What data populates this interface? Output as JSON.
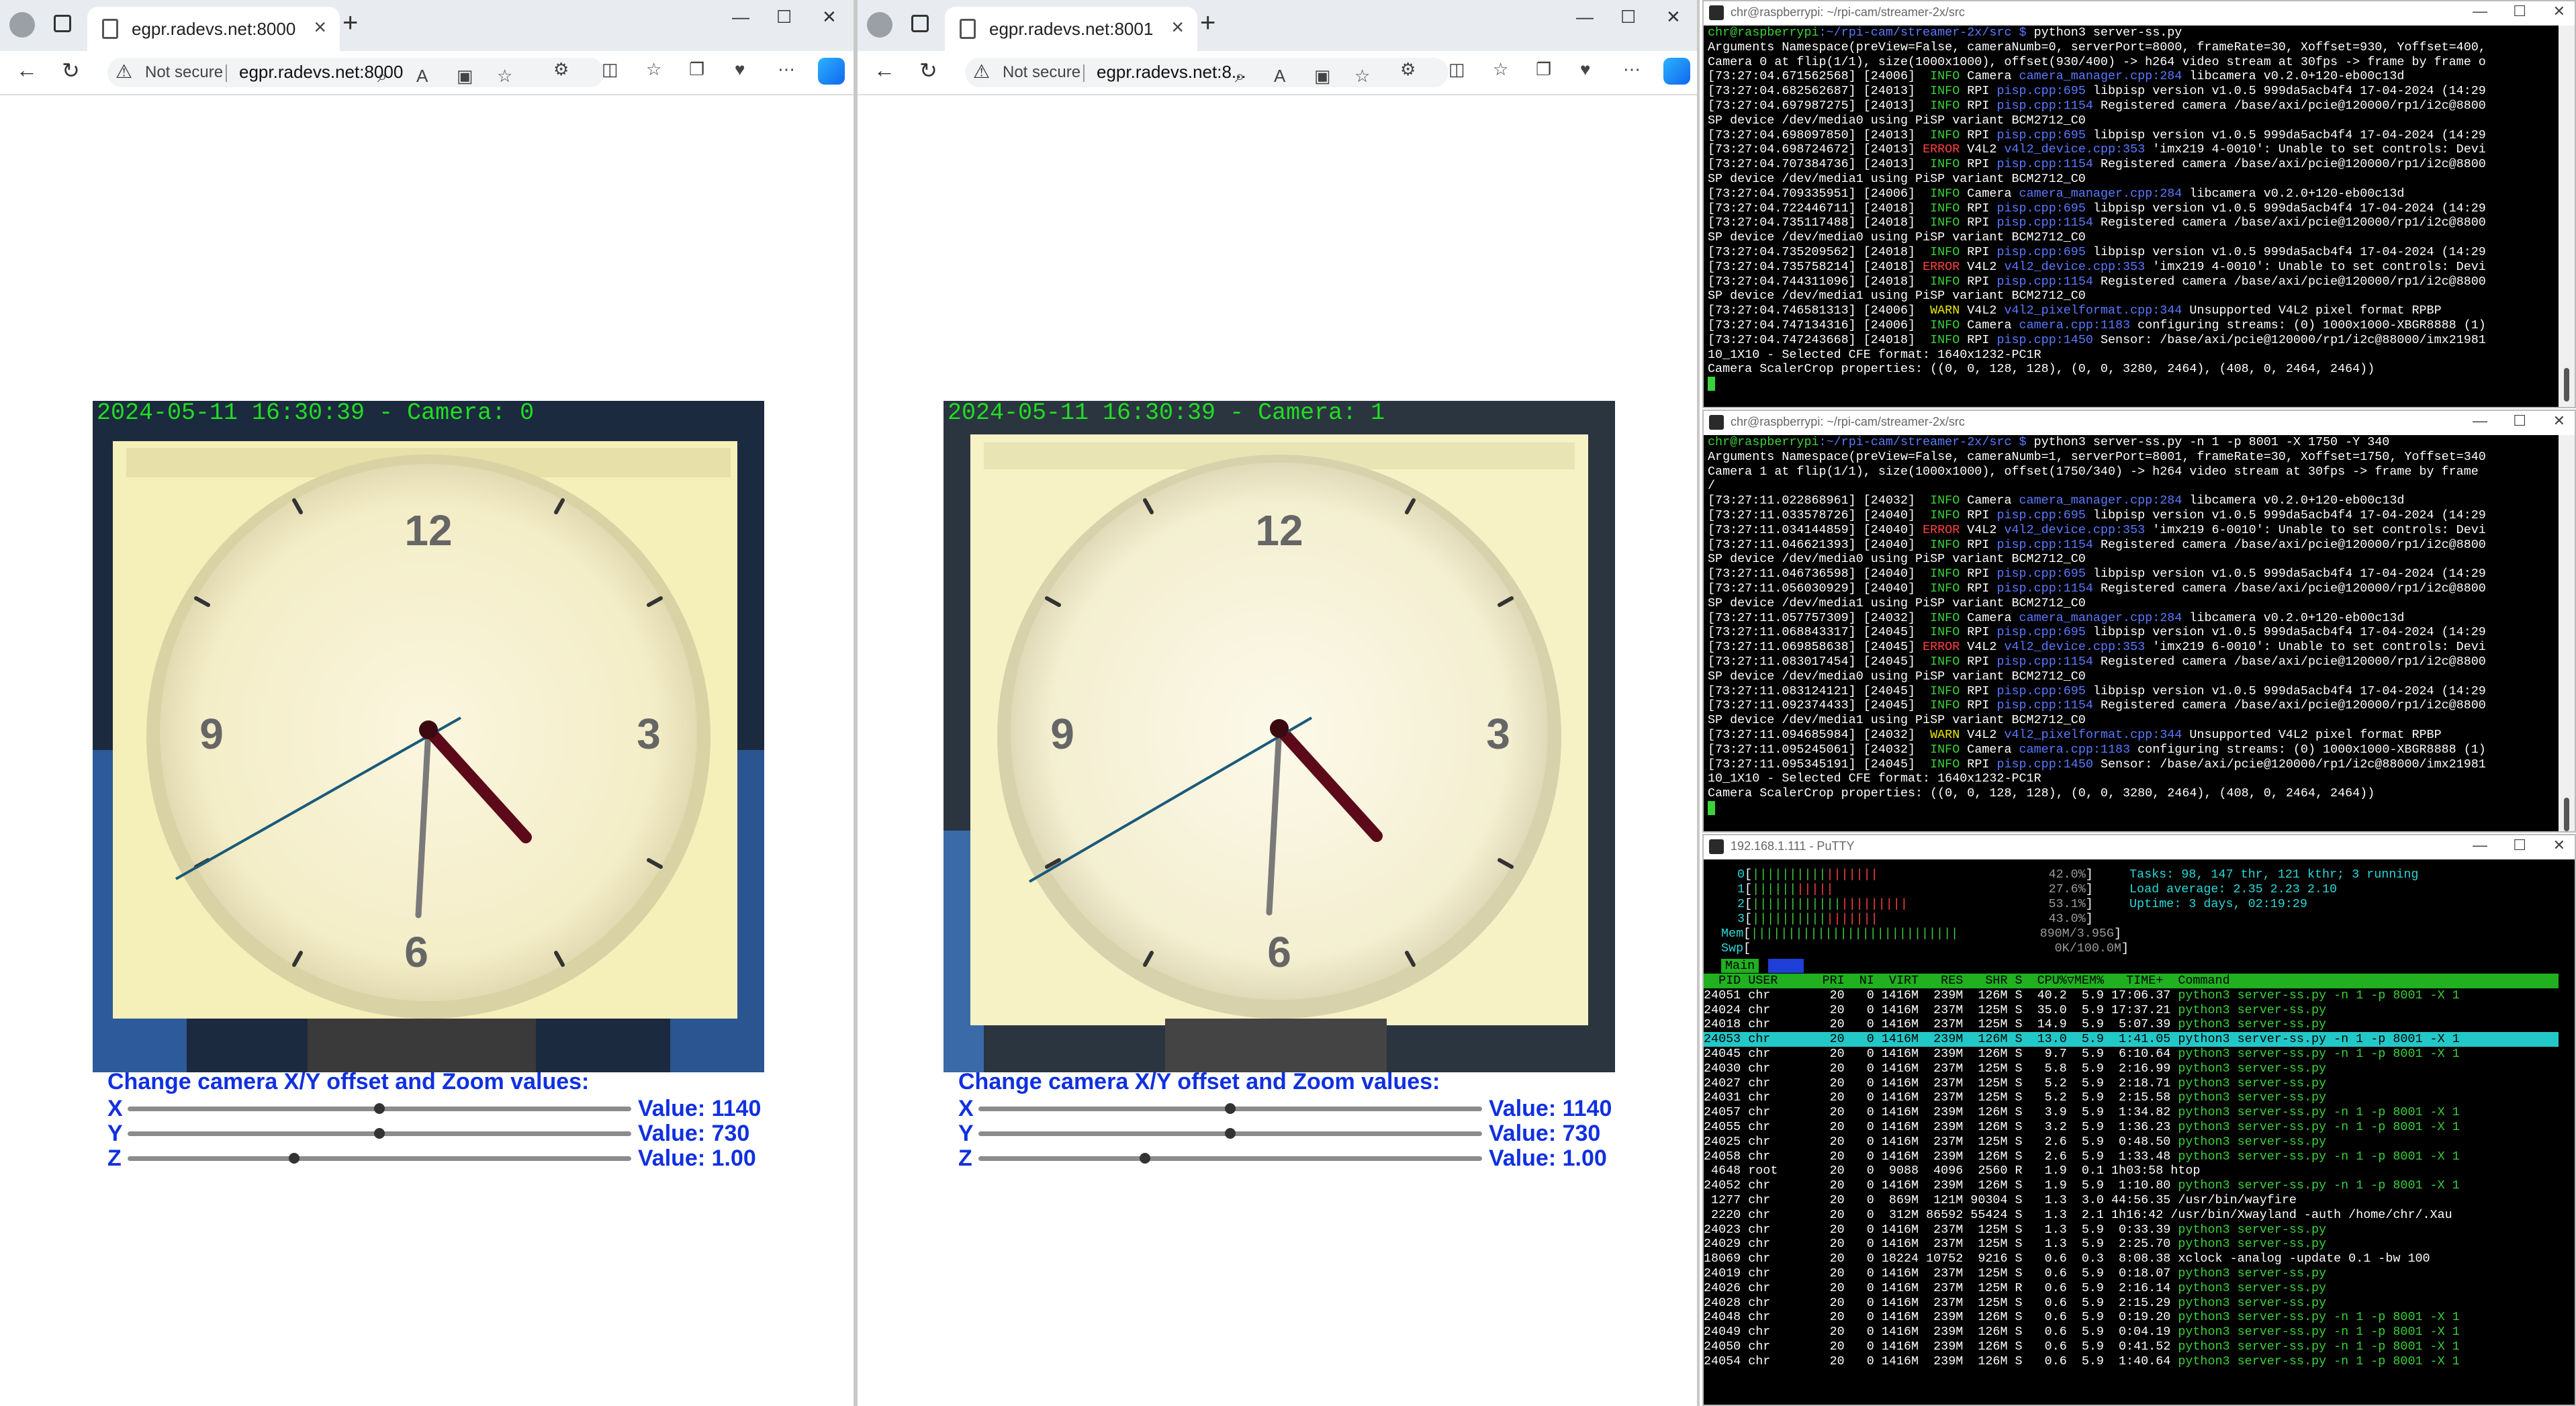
{
  "browser": {
    "address_warning": "Not secure",
    "windows": [
      {
        "tab_title": "egpr.radevs.net:8000",
        "url": "egpr.radevs.net:8000",
        "camera_overlay": "2024-05-11 16:30:39 - Camera: 0",
        "controls": {
          "title": "Change camera X/Y offset and Zoom values:",
          "sliders": [
            {
              "label": "X",
              "value_text": "Value: 1140",
              "fraction": 0.5
            },
            {
              "label": "Y",
              "value_text": "Value: 730",
              "fraction": 0.5
            },
            {
              "label": "Z",
              "value_text": "Value: 1.00",
              "fraction": 0.33
            }
          ]
        }
      },
      {
        "tab_title": "egpr.radevs.net:8001",
        "url": "egpr.radevs.net:8...",
        "camera_overlay": "2024-05-11 16:30:39 - Camera: 1",
        "controls": {
          "title": "Change camera X/Y offset and Zoom values:",
          "sliders": [
            {
              "label": "X",
              "value_text": "Value: 1140",
              "fraction": 0.5
            },
            {
              "label": "Y",
              "value_text": "Value: 730",
              "fraction": 0.5
            },
            {
              "label": "Z",
              "value_text": "Value: 1.00",
              "fraction": 0.33
            }
          ]
        }
      }
    ],
    "clock_numerals": [
      "12",
      "3",
      "6",
      "9"
    ]
  },
  "terminal1": {
    "title": "chr@raspberrypi: ~/rpi-cam/streamer-2x/src",
    "prompt": "chr@raspberrypi",
    "path": ":~/rpi-cam/streamer-2x/src $ ",
    "command": "python3 server-ss.py",
    "lines": [
      "Arguments Namespace(preView=False, cameraNumb=0, serverPort=8000, frameRate=30, Xoffset=930, Yoffset=400,",
      "Camera 0 at flip(1/1), size(1000x1000), offset(930/400) -> h264 video stream at 30fps -> frame by frame o",
      "[73:27:04.671562568] [24006]  INFO Camera camera_manager.cpp:284 libcamera v0.2.0+120-eb00c13d",
      "[73:27:04.682562687] [24013]  INFO RPI pisp.cpp:695 libpisp version v1.0.5 999da5acb4f4 17-04-2024 (14:29",
      "[73:27:04.697987275] [24013]  INFO RPI pisp.cpp:1154 Registered camera /base/axi/pcie@120000/rp1/i2c@8800",
      "SP device /dev/media0 using PiSP variant BCM2712_C0",
      "[73:27:04.698097850] [24013]  INFO RPI pisp.cpp:695 libpisp version v1.0.5 999da5acb4f4 17-04-2024 (14:29",
      "[73:27:04.698724672] [24013] ERROR V4L2 v4l2_device.cpp:353 'imx219 4-0010': Unable to set controls: Devi",
      "[73:27:04.707384736] [24013]  INFO RPI pisp.cpp:1154 Registered camera /base/axi/pcie@120000/rp1/i2c@8800",
      "SP device /dev/media1 using PiSP variant BCM2712_C0",
      "[73:27:04.709335951] [24006]  INFO Camera camera_manager.cpp:284 libcamera v0.2.0+120-eb00c13d",
      "[73:27:04.722446711] [24018]  INFO RPI pisp.cpp:695 libpisp version v1.0.5 999da5acb4f4 17-04-2024 (14:29",
      "[73:27:04.735117488] [24018]  INFO RPI pisp.cpp:1154 Registered camera /base/axi/pcie@120000/rp1/i2c@8800",
      "SP device /dev/media0 using PiSP variant BCM2712_C0",
      "[73:27:04.735209562] [24018]  INFO RPI pisp.cpp:695 libpisp version v1.0.5 999da5acb4f4 17-04-2024 (14:29",
      "[73:27:04.735758214] [24018] ERROR V4L2 v4l2_device.cpp:353 'imx219 4-0010': Unable to set controls: Devi",
      "[73:27:04.744311096] [24018]  INFO RPI pisp.cpp:1154 Registered camera /base/axi/pcie@120000/rp1/i2c@8800",
      "SP device /dev/media1 using PiSP variant BCM2712_C0",
      "[73:27:04.746581313] [24006]  WARN V4L2 v4l2_pixelformat.cpp:344 Unsupported V4L2 pixel format RPBP",
      "[73:27:04.747134316] [24006]  INFO Camera camera.cpp:1183 configuring streams: (0) 1000x1000-XBGR8888 (1)",
      "[73:27:04.747243668] [24018]  INFO RPI pisp.cpp:1450 Sensor: /base/axi/pcie@120000/rp1/i2c@88000/imx21981",
      "10_1X10 - Selected CFE format: 1640x1232-PC1R",
      "Camera ScalerCrop properties: ((0, 0, 128, 128), (0, 0, 3280, 2464), (408, 0, 2464, 2464))"
    ]
  },
  "terminal2": {
    "title": "chr@raspberrypi: ~/rpi-cam/streamer-2x/src",
    "prompt": "chr@raspberrypi",
    "path": ":~/rpi-cam/streamer-2x/src $ ",
    "command": "python3 server-ss.py -n 1 -p 8001 -X 1750 -Y 340",
    "lines": [
      "Arguments Namespace(preView=False, cameraNumb=1, serverPort=8001, frameRate=30, Xoffset=1750, Yoffset=340",
      "Camera 1 at flip(1/1), size(1000x1000), offset(1750/340) -> h264 video stream at 30fps -> frame by frame",
      "/",
      "[73:27:11.022868961] [24032]  INFO Camera camera_manager.cpp:284 libcamera v0.2.0+120-eb00c13d",
      "[73:27:11.033578726] [24040]  INFO RPI pisp.cpp:695 libpisp version v1.0.5 999da5acb4f4 17-04-2024 (14:29",
      "[73:27:11.034144859] [24040] ERROR V4L2 v4l2_device.cpp:353 'imx219 6-0010': Unable to set controls: Devi",
      "[73:27:11.046621393] [24040]  INFO RPI pisp.cpp:1154 Registered camera /base/axi/pcie@120000/rp1/i2c@8800",
      "SP device /dev/media0 using PiSP variant BCM2712_C0",
      "[73:27:11.046736598] [24040]  INFO RPI pisp.cpp:695 libpisp version v1.0.5 999da5acb4f4 17-04-2024 (14:29",
      "[73:27:11.056030929] [24040]  INFO RPI pisp.cpp:1154 Registered camera /base/axi/pcie@120000/rp1/i2c@8800",
      "SP device /dev/media1 using PiSP variant BCM2712_C0",
      "[73:27:11.057757309] [24032]  INFO Camera camera_manager.cpp:284 libcamera v0.2.0+120-eb00c13d",
      "[73:27:11.068843317] [24045]  INFO RPI pisp.cpp:695 libpisp version v1.0.5 999da5acb4f4 17-04-2024 (14:29",
      "[73:27:11.069858638] [24045] ERROR V4L2 v4l2_device.cpp:353 'imx219 6-0010': Unable to set controls: Devi",
      "[73:27:11.083017454] [24045]  INFO RPI pisp.cpp:1154 Registered camera /base/axi/pcie@120000/rp1/i2c@8800",
      "SP device /dev/media0 using PiSP variant BCM2712_C0",
      "[73:27:11.083124121] [24045]  INFO RPI pisp.cpp:695 libpisp version v1.0.5 999da5acb4f4 17-04-2024 (14:29",
      "[73:27:11.092374433] [24045]  INFO RPI pisp.cpp:1154 Registered camera /base/axi/pcie@120000/rp1/i2c@8800",
      "SP device /dev/media1 using PiSP variant BCM2712_C0",
      "[73:27:11.094685984] [24032]  WARN V4L2 v4l2_pixelformat.cpp:344 Unsupported V4L2 pixel format RPBP",
      "[73:27:11.095245061] [24032]  INFO Camera camera.cpp:1183 configuring streams: (0) 1000x1000-XBGR8888 (1)",
      "[73:27:11.095345191] [24045]  INFO RPI pisp.cpp:1450 Sensor: /base/axi/pcie@120000/rp1/i2c@88000/imx21981",
      "10_1X10 - Selected CFE format: 1640x1232-PC1R",
      "Camera ScalerCrop properties: ((0, 0, 128, 128), (0, 0, 3280, 2464), (408, 0, 2464, 2464))"
    ]
  },
  "putty": {
    "title": "192.168.1.111 - PuTTY",
    "cpu": [
      {
        "label": "0",
        "pct": "42.0%"
      },
      {
        "label": "1",
        "pct": "27.6%"
      },
      {
        "label": "2",
        "pct": "53.1%"
      },
      {
        "label": "3",
        "pct": "43.0%"
      }
    ],
    "mem": {
      "label": "Mem",
      "value": "890M/3.95G"
    },
    "swp": {
      "label": "Swp",
      "value": "0K/100.0M"
    },
    "tasks": "Tasks: 98, 147 thr, 121 kthr; 3 running",
    "load": "Load average: 2.35 2.23 2.10",
    "uptime": "Uptime: 3 days, 02:19:29",
    "tab_main": "Main",
    "tab_io": "I/O",
    "header": "  PID USER      PRI  NI  VIRT   RES   SHR S  CPU%▽MEM%   TIME+  Command",
    "selected_index": 3,
    "rows": [
      "24051 chr        20   0 1416M  239M  126M S  40.2  5.9 17:06.37 python3 server-ss.py -n 1 -p 8001 -X 1",
      "24024 chr        20   0 1416M  237M  125M S  35.0  5.9 17:37.21 python3 server-ss.py",
      "24018 chr        20   0 1416M  237M  125M S  14.9  5.9  5:07.39 python3 server-ss.py",
      "24053 chr        20   0 1416M  239M  126M S  13.0  5.9  1:41.05 python3 server-ss.py -n 1 -p 8001 -X 1",
      "24045 chr        20   0 1416M  239M  126M S   9.7  5.9  6:10.64 python3 server-ss.py -n 1 -p 8001 -X 1",
      "24030 chr        20   0 1416M  237M  125M S   5.8  5.9  2:16.99 python3 server-ss.py",
      "24027 chr        20   0 1416M  237M  125M S   5.2  5.9  2:18.71 python3 server-ss.py",
      "24031 chr        20   0 1416M  237M  125M S   5.2  5.9  2:15.58 python3 server-ss.py",
      "24057 chr        20   0 1416M  239M  126M S   3.9  5.9  1:34.82 python3 server-ss.py -n 1 -p 8001 -X 1",
      "24055 chr        20   0 1416M  239M  126M S   3.2  5.9  1:36.23 python3 server-ss.py -n 1 -p 8001 -X 1",
      "24025 chr        20   0 1416M  237M  125M S   2.6  5.9  0:48.50 python3 server-ss.py",
      "24058 chr        20   0 1416M  239M  126M S   2.6  5.9  1:33.48 python3 server-ss.py -n 1 -p 8001 -X 1",
      " 4648 root       20   0  9088  4096  2560 R   1.9  0.1 1h03:58 htop",
      "24052 chr        20   0 1416M  239M  126M S   1.9  5.9  1:10.80 python3 server-ss.py -n 1 -p 8001 -X 1",
      " 1277 chr        20   0  869M  121M 90304 S   1.3  3.0 44:56.35 /usr/bin/wayfire",
      " 2220 chr        20   0  312M 86592 55424 S   1.3  2.1 1h16:42 /usr/bin/Xwayland -auth /home/chr/.Xau",
      "24023 chr        20   0 1416M  237M  125M S   1.3  5.9  0:33.39 python3 server-ss.py",
      "24029 chr        20   0 1416M  237M  125M S   1.3  5.9  2:25.70 python3 server-ss.py",
      "18069 chr        20   0 18224 10752  9216 S   0.6  0.3  8:08.38 xclock -analog -update 0.1 -bw 100",
      "24019 chr        20   0 1416M  237M  125M S   0.6  5.9  0:18.07 python3 server-ss.py",
      "24026 chr        20   0 1416M  237M  125M R   0.6  5.9  2:16.14 python3 server-ss.py",
      "24028 chr        20   0 1416M  237M  125M S   0.6  5.9  2:15.29 python3 server-ss.py",
      "24048 chr        20   0 1416M  239M  126M S   0.6  5.9  0:19.20 python3 server-ss.py -n 1 -p 8001 -X 1",
      "24049 chr        20   0 1416M  239M  126M S   0.6  5.9  0:04.19 python3 server-ss.py -n 1 -p 8001 -X 1",
      "24050 chr        20   0 1416M  239M  126M S   0.6  5.9  0:41.52 python3 server-ss.py -n 1 -p 8001 -X 1",
      "24054 chr        20   0 1416M  239M  126M S   0.6  5.9  1:40.64 python3 server-ss.py -n 1 -p 8001 -X 1"
    ]
  },
  "colors": {
    "overlay_green": "#22dd22",
    "control_blue": "#1030e0",
    "htop_cyan": "#22c8c8",
    "htop_green": "#20b020"
  }
}
